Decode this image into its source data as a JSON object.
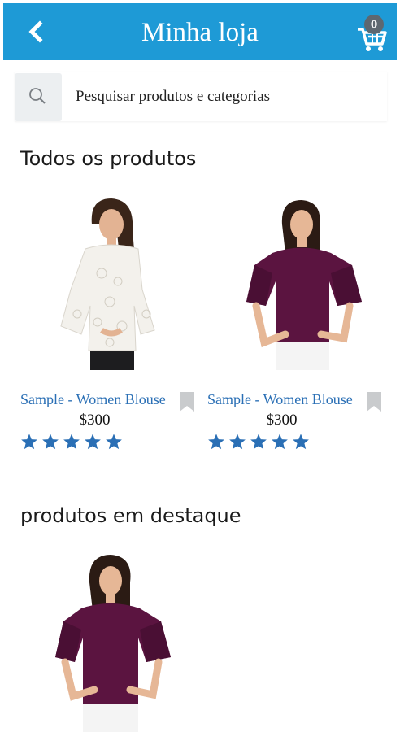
{
  "header": {
    "title": "Minha loja",
    "back_icon": "chevron-left-icon",
    "cart_icon": "cart-icon",
    "cart_count": "0"
  },
  "search": {
    "placeholder": "Pesquisar produtos e categorias",
    "icon": "search-icon"
  },
  "sections": {
    "all_products": "Todos os produtos",
    "featured": "produtos em destaque"
  },
  "products": [
    {
      "name": "Sample - Women Blouse",
      "price": "$300",
      "rating": 5,
      "image": "white-lace-top"
    },
    {
      "name": "Sample - Women Blouse",
      "price": "$300",
      "rating": 5,
      "image": "purple-ruffle-top"
    }
  ],
  "featured_products": [
    {
      "image": "purple-ruffle-top"
    }
  ],
  "colors": {
    "primary": "#1e9ad6",
    "link": "#2a6fb5",
    "star": "#2a6fb5",
    "badge": "#5d6770"
  }
}
